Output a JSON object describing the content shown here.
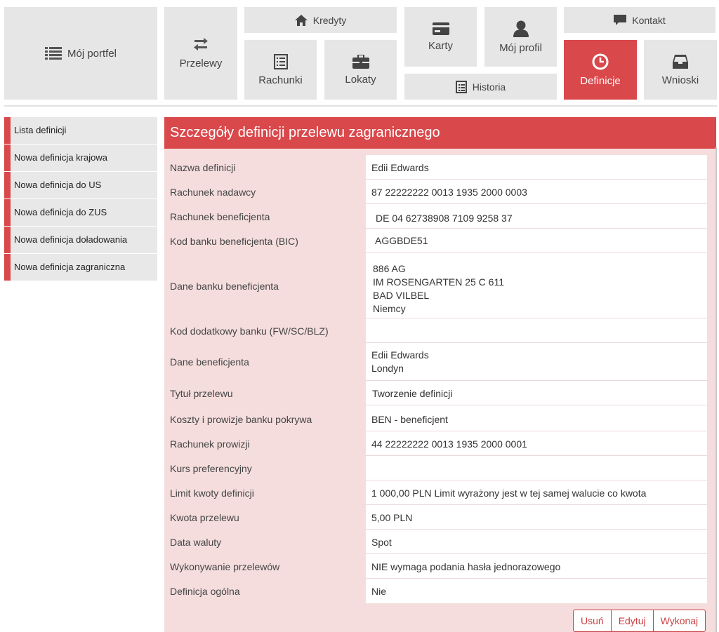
{
  "nav": {
    "moj_portfel": "Mój portfel",
    "przelewy": "Przelewy",
    "kredyty": "Kredyty",
    "rachunki": "Rachunki",
    "lokaty": "Lokaty",
    "karty": "Karty",
    "moj_profil": "Mój profil",
    "historia": "Historia",
    "kontakt": "Kontakt",
    "definicje": "Definicje",
    "wnioski": "Wnioski",
    "active_item": "definicje",
    "accent_color": "#d9484b"
  },
  "sidebar": {
    "items": [
      "Lista definicji",
      "Nowa definicja krajowa",
      "Nowa definicja do US",
      "Nowa definicja do ZUS",
      "Nowa definicja doładowania",
      "Nowa definicja zagraniczna"
    ]
  },
  "panel": {
    "title": "Szczegóły definicji przelewu zagranicznego",
    "rows": [
      {
        "label": "Nazwa definicji",
        "value": [
          "Edii Edwards"
        ]
      },
      {
        "label": "Rachunek nadawcy",
        "value": [
          "87 22222222 0013 1935 2000 0003"
        ]
      },
      {
        "label": "Rachunek beneficjenta",
        "value": [
          "DE 04 62738908 7109 9258 37"
        ]
      },
      {
        "label": "Kod banku beneficjenta (BIC)",
        "value": [
          "AGGBDE51"
        ]
      },
      {
        "label": "Dane banku beneficjenta",
        "value": [
          "886 AG",
          "IM ROSENGARTEN 25 C 611",
          "BAD VILBEL",
          "Niemcy"
        ]
      },
      {
        "label": "Kod dodatkowy banku (FW/SC/BLZ)",
        "value": [
          ""
        ]
      },
      {
        "label": "Dane beneficjenta",
        "value": [
          "Edii Edwards",
          "Londyn"
        ]
      },
      {
        "label": "Tytuł przelewu",
        "value": [
          "Tworzenie definicji"
        ]
      },
      {
        "label": "Koszty i prowizje banku pokrywa",
        "value": [
          "BEN - beneficjent"
        ]
      },
      {
        "label": "Rachunek prowizji",
        "value": [
          "44 22222222 0013 1935 2000 0001"
        ]
      },
      {
        "label": "Kurs preferencyjny",
        "value": [
          ""
        ]
      },
      {
        "label": "Limit kwoty definicji",
        "value": [
          "1 000,00 PLN Limit wyrażony jest w tej samej walucie co kwota"
        ]
      },
      {
        "label": "Kwota przelewu",
        "value": [
          "5,00 PLN"
        ]
      },
      {
        "label": "Data waluty",
        "value": [
          "Spot"
        ]
      },
      {
        "label": "Wykonywanie przelewów",
        "value": [
          "NIE wymaga podania hasła jednorazowego"
        ]
      },
      {
        "label": "Definicja ogólna",
        "value": [
          "Nie"
        ]
      }
    ],
    "buttons": {
      "delete": "Usuń",
      "edit": "Edytuj",
      "execute": "Wykonaj"
    }
  }
}
